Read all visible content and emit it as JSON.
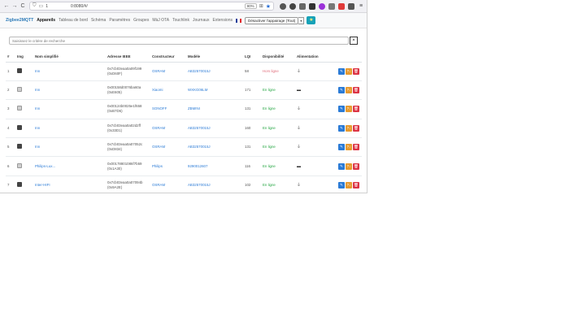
{
  "browser": {
    "back_icon": "←",
    "forward_icon": "→",
    "reload_icon": "C",
    "url_prefix": "1",
    "url": "0:8080/#/",
    "zoom": "90%"
  },
  "nav": {
    "brand": "Zigbee2MQTT",
    "links": [
      {
        "label": "Appareils",
        "active": true
      },
      {
        "label": "Tableau de bord"
      },
      {
        "label": "Schéma"
      },
      {
        "label": "Paramètres"
      },
      {
        "label": "Groupes"
      },
      {
        "label": "MàJ OTA"
      },
      {
        "label": "Touchlink"
      },
      {
        "label": "Journaux"
      },
      {
        "label": "Extensions"
      }
    ],
    "permit_join_select": "Désactiver l'appairage (Tout)",
    "caret": "▾",
    "star": "★"
  },
  "search": {
    "placeholder": "Saisissez le critère de recherche",
    "clear": "×"
  },
  "table": {
    "headers": [
      "#",
      "Img",
      "Nom simplifié",
      "Adresse IEEE",
      "Constructeur",
      "Modèle",
      "LQI",
      "Disponibilité",
      "Alimentation"
    ],
    "rows": [
      {
        "n": "1",
        "img": "dark",
        "name": "Inn",
        "ieee": "0x7cb03eaa0a09f199",
        "nwk": "(0xD60F)",
        "vendor": "OSRAM",
        "model": "AB32570015J",
        "lqi": "58",
        "avail": "Hors ligne",
        "online": false,
        "power": "plug"
      },
      {
        "n": "2",
        "img": "light",
        "name": "Inn",
        "ieee": "0x00158d0076ba60a",
        "nwk": "(0xE605)",
        "vendor": "Xiaomi",
        "model": "WXKG06LM",
        "lqi": "171",
        "avail": "En ligne",
        "online": true,
        "power": "battery"
      },
      {
        "n": "3",
        "img": "light",
        "name": "Inn",
        "ieee": "0x00124b0025e1f658",
        "nwk": "(0xB7D6)",
        "vendor": "SONOFF",
        "model": "ZBMINI",
        "lqi": "131",
        "avail": "En ligne",
        "online": true,
        "power": "plug"
      },
      {
        "n": "4",
        "img": "dark",
        "name": "Inn",
        "ieee": "0x7cb03eaa0a02d2ff",
        "nwk": "(0x33D1)",
        "vendor": "OSRAM",
        "model": "AB32570015J",
        "lqi": "160",
        "avail": "En ligne",
        "online": true,
        "power": "plug"
      },
      {
        "n": "5",
        "img": "dark",
        "name": "Inn",
        "ieee": "0x7cb03eaa0a07052c",
        "nwk": "(0xD834)",
        "vendor": "OSRAM",
        "model": "AB32570015J",
        "lqi": "131",
        "avail": "En ligne",
        "online": true,
        "power": "plug"
      },
      {
        "n": "6",
        "img": "light",
        "name": "Philips-Lux...",
        "ieee": "0x00178801086f7b59",
        "nwk": "(0x1A30)",
        "vendor": "Philips",
        "model": "9290012607",
        "lqi": "116",
        "avail": "En ligne",
        "online": true,
        "power": "battery"
      },
      {
        "n": "7",
        "img": "dark",
        "name": "Inter-HIFI",
        "ieee": "0x7cb03eaa0a07094b",
        "nwk": "(0x9A2E)",
        "vendor": "OSRAM",
        "model": "AB32570015J",
        "lqi": "102",
        "avail": "En ligne",
        "online": true,
        "power": "plug"
      }
    ],
    "actions": {
      "edit": "✎",
      "info": "?↓",
      "delete": "🗑"
    }
  }
}
